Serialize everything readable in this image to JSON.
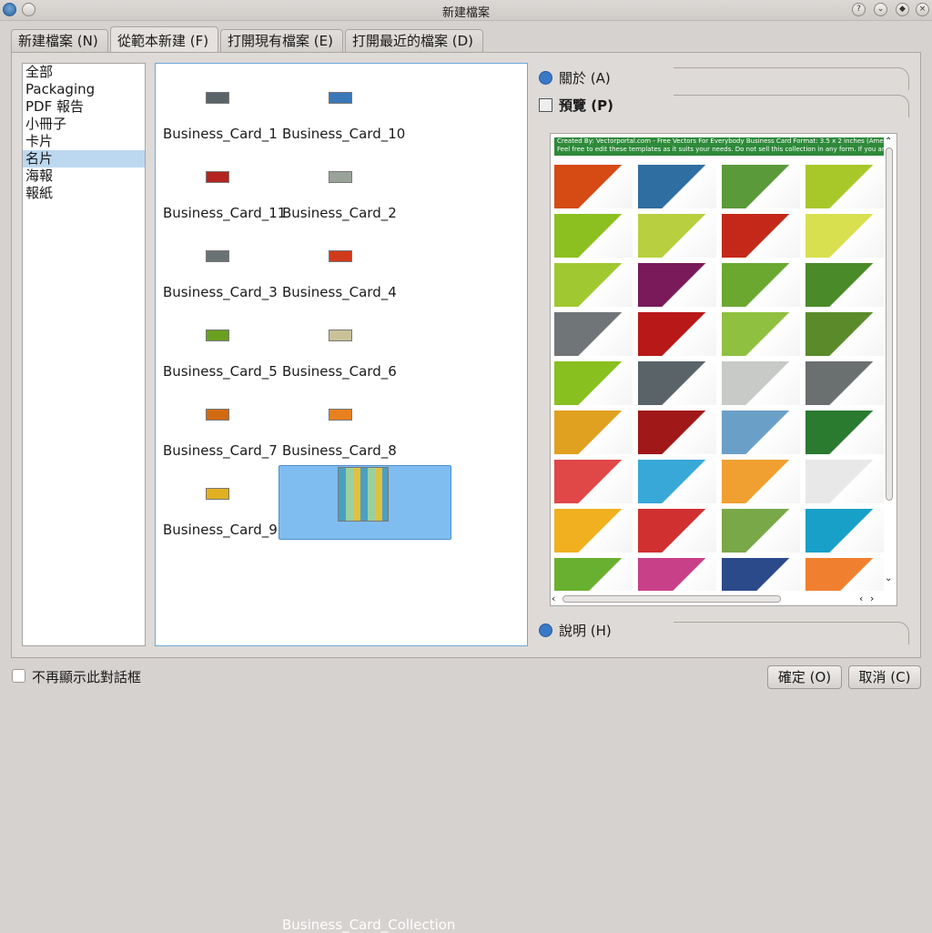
{
  "window": {
    "title": "新建檔案"
  },
  "tabs": [
    "新建檔案 (N)",
    "從範本新建 (F)",
    "打開現有檔案 (E)",
    "打開最近的檔案 (D)"
  ],
  "categories": [
    "全部",
    "Packaging",
    "PDF 報告",
    "小冊子",
    "卡片",
    "名片",
    "海報",
    "報紙"
  ],
  "selected_category": "名片",
  "templates": [
    {
      "name": "Business_Card_1",
      "thumb_color": "#5a6468"
    },
    {
      "name": "Business_Card_10",
      "thumb_color": "#3a78b8"
    },
    {
      "name": "Business_Card_11",
      "thumb_color": "#b5241f"
    },
    {
      "name": "Business_Card_2",
      "thumb_color": "#9aa39a"
    },
    {
      "name": "Business_Card_3",
      "thumb_color": "#6b7275"
    },
    {
      "name": "Business_Card_4",
      "thumb_color": "#d03a1c"
    },
    {
      "name": "Business_Card_5",
      "thumb_color": "#6aa020"
    },
    {
      "name": "Business_Card_6",
      "thumb_color": "#c9c299"
    },
    {
      "name": "Business_Card_7",
      "thumb_color": "#d46a10"
    },
    {
      "name": "Business_Card_8",
      "thumb_color": "#e88020"
    },
    {
      "name": "Business_Card_9",
      "thumb_color": "#e0b020"
    },
    {
      "name": "Business_Card_Collection",
      "thumb_color": "#3f8fb8"
    }
  ],
  "selected_template": "Business_Card_Collection",
  "sections": {
    "about": "關於 (A)",
    "preview": "預覽 (P)",
    "help": "說明 (H)"
  },
  "preview_header": {
    "line1": "Created By: Vectorportal.com - Free Vectors For Everybody     Business Card Format: 3.5 x 2 inches (American format)     License: Free For P",
    "line2": "Feel free to edit these templates as it suits your needs. Do not sell this collection in any form. If you are going to distribute it further, please"
  },
  "preview_cards": [
    "#d64a14",
    "#2f6ea0",
    "#5a9a3a",
    "#a8c82a",
    "#8cc020",
    "#b8d040",
    "#c42818",
    "#d8e050",
    "#a0c830",
    "#7a1a5a",
    "#6aa830",
    "#4a8a28",
    "#707578",
    "#b81818",
    "#90c040",
    "#5a8a2a",
    "#88c020",
    "#5a6468",
    "#c8cac8",
    "#6a6f70",
    "#e0a020",
    "#a01818",
    "#6aa0c8",
    "#2a7a30",
    "#e04848",
    "#38a8d8",
    "#f0a030",
    "#e8e8e8",
    "#f0b020",
    "#d03030",
    "#78a848",
    "#18a0c8",
    "#6ab030",
    "#c84088",
    "#2a4a8a",
    "#f08030"
  ],
  "dont_show_again": "不再顯示此對話框",
  "buttons": {
    "ok": "確定 (O)",
    "cancel": "取消 (C)"
  }
}
